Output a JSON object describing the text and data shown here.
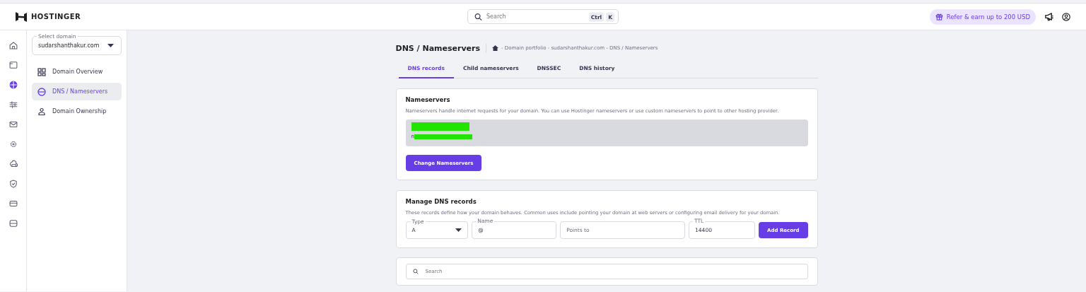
{
  "topbar": {
    "brand": "HOSTINGER",
    "search": {
      "placeholder": "Search",
      "keys": [
        "Ctrl",
        "K"
      ]
    },
    "refer": "Refer & earn up to 200 USD"
  },
  "rail": [
    {
      "kind": "home",
      "selected": false
    },
    {
      "kind": "window",
      "selected": false
    },
    {
      "kind": "globe",
      "selected": true
    },
    {
      "kind": "sliders",
      "selected": false
    },
    {
      "kind": "mail",
      "selected": false
    },
    {
      "kind": "gear",
      "selected": false
    },
    {
      "kind": "cloud",
      "selected": false
    },
    {
      "kind": "shield",
      "selected": false
    },
    {
      "kind": "card",
      "selected": false
    },
    {
      "kind": "server",
      "selected": false
    }
  ],
  "sidebar": {
    "domain_select": {
      "label": "Select domain",
      "value": "sudarshanthakur.com"
    },
    "items": [
      {
        "kind": "grid",
        "label": "Domain Overview",
        "selected": false
      },
      {
        "kind": "globe",
        "label": "DNS / Nameservers",
        "selected": true
      },
      {
        "kind": "person",
        "label": "Domain Ownership",
        "selected": false
      }
    ]
  },
  "header": {
    "title": "DNS / Nameservers",
    "breadcrumb": "- Domain portfolio - sudarshanthakur.com - DNS / Nameservers"
  },
  "tabs": [
    {
      "label": "DNS records",
      "selected": true
    },
    {
      "label": "Child nameservers",
      "selected": false
    },
    {
      "label": "DNSSEC",
      "selected": false
    },
    {
      "label": "DNS history",
      "selected": false
    }
  ],
  "nameservers": {
    "title": "Nameservers",
    "description": "Nameservers handle internet requests for your domain. You can use Hostinger nameservers or use custom nameservers to point to other hosting provider.",
    "second_line_start": "n",
    "button": "Change Nameservers"
  },
  "manage": {
    "title": "Manage DNS records",
    "description": "These records define how your domain behaves. Common uses include pointing your domain at web servers or configuring email delivery for your domain.",
    "type": {
      "label": "Type",
      "value": "A"
    },
    "name": {
      "label": "Name",
      "value": "@"
    },
    "points_to": {
      "placeholder": "Points to"
    },
    "ttl": {
      "label": "TTL",
      "value": "14400"
    },
    "button": "Add Record"
  },
  "records_search": {
    "placeholder": "Search"
  }
}
